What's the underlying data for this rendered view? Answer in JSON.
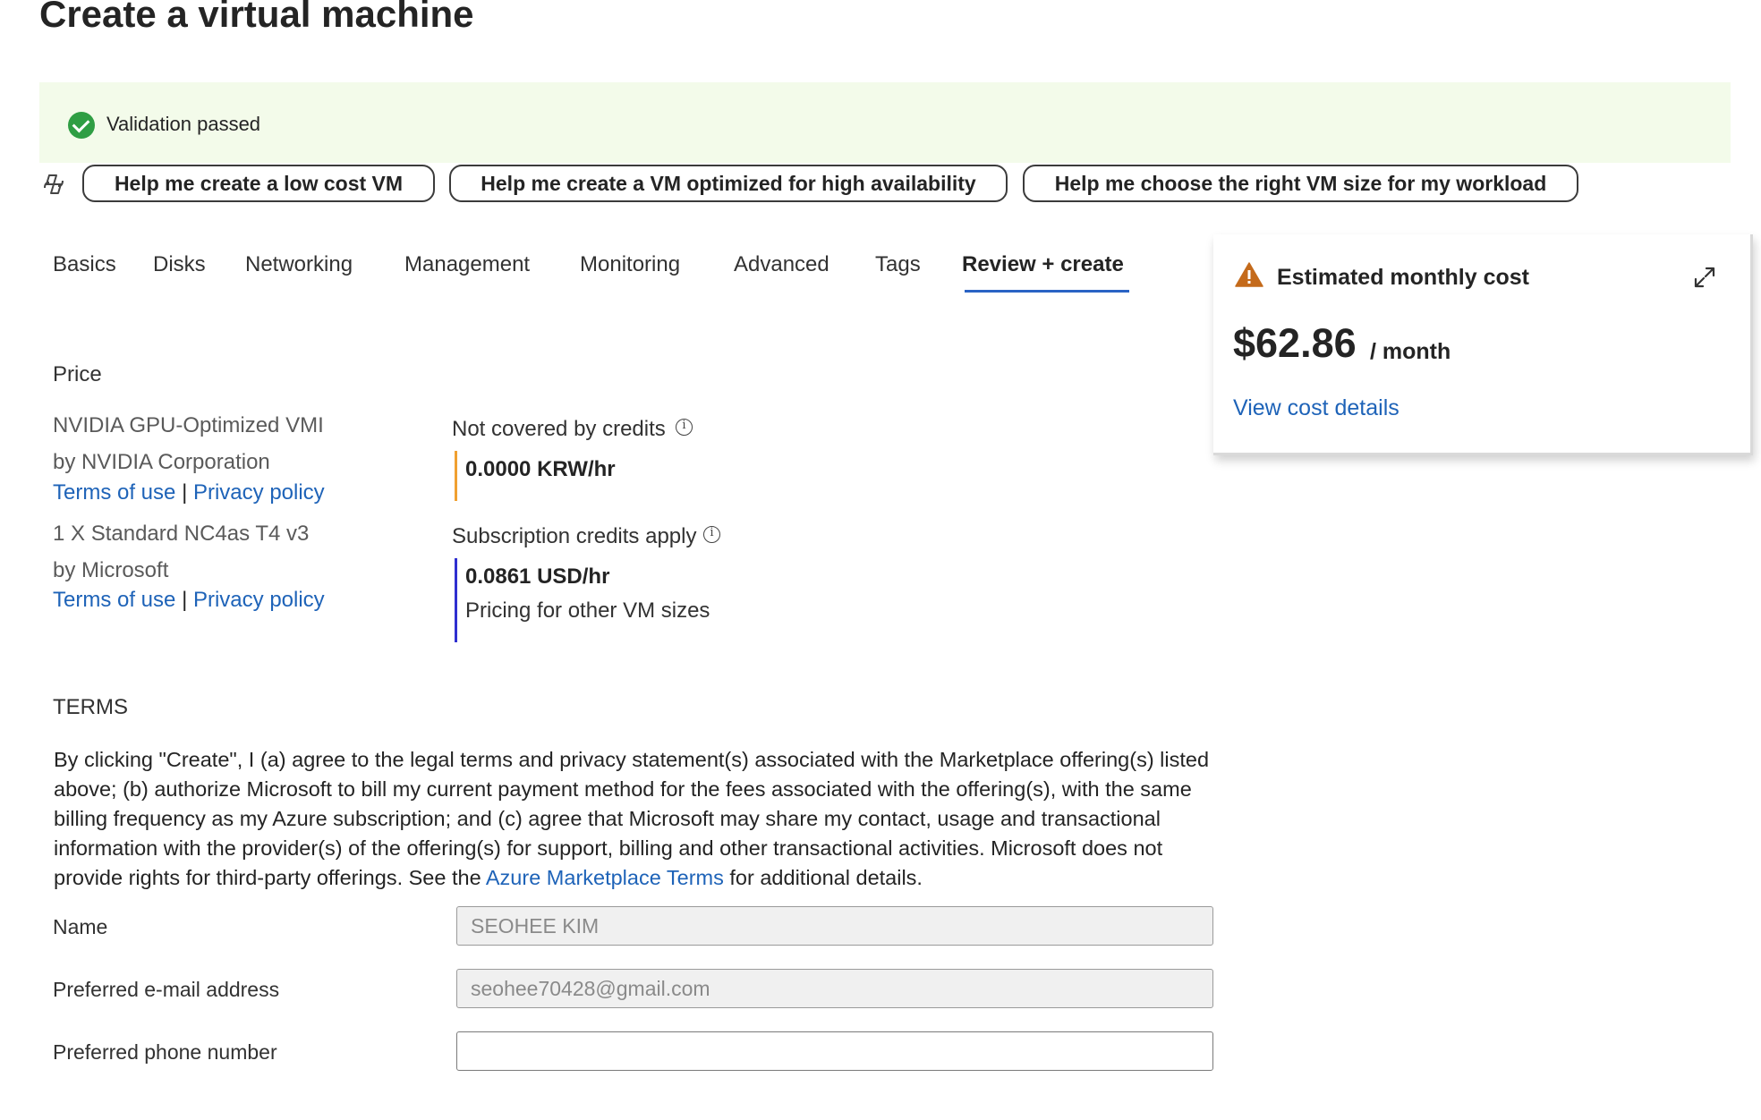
{
  "page": {
    "title": "Create a virtual machine"
  },
  "validation": {
    "text": "Validation passed",
    "color": "#2f9e44"
  },
  "copilot": {
    "icon": "copilot-icon",
    "suggestions": [
      "Help me create a low cost VM",
      "Help me create a VM optimized for high availability",
      "Help me choose the right VM size for my workload"
    ]
  },
  "tabs": [
    {
      "label": "Basics"
    },
    {
      "label": "Disks"
    },
    {
      "label": "Networking"
    },
    {
      "label": "Management"
    },
    {
      "label": "Monitoring"
    },
    {
      "label": "Advanced"
    },
    {
      "label": "Tags"
    },
    {
      "label": "Review + create",
      "active": true
    }
  ],
  "cost_card": {
    "title": "Estimated monthly cost",
    "amount": "$62.86",
    "period": "/ month",
    "link": "View cost details",
    "warning_icon": "warning-icon",
    "expand_icon": "expand-icon"
  },
  "price": {
    "heading": "Price",
    "items": [
      {
        "name": "NVIDIA GPU-Optimized VMI",
        "publisher": "by NVIDIA Corporation",
        "terms": "Terms of use",
        "separator": "|",
        "privacy": "Privacy policy"
      },
      {
        "name": "1 X Standard NC4as T4 v3",
        "publisher": "by Microsoft",
        "terms": "Terms of use",
        "separator": "|",
        "privacy": "Privacy policy"
      }
    ],
    "not_covered": {
      "label": "Not covered by credits",
      "value": "0.0000 KRW/hr"
    },
    "credits_apply": {
      "label": "Subscription credits apply",
      "value": "0.0861 USD/hr",
      "link": "Pricing for other VM sizes"
    }
  },
  "terms": {
    "heading": "TERMS",
    "body_before": "By clicking \"Create\", I (a) agree to the legal terms and privacy statement(s) associated with the Marketplace offering(s) listed above; (b) authorize Microsoft to bill my current payment method for the fees associated with the offering(s), with the same billing frequency as my Azure subscription; and (c) agree that Microsoft may share my contact, usage and transactional information with the provider(s) of the offering(s) for support, billing and other transactional activities. Microsoft does not provide rights for third-party offerings. See the ",
    "link": "Azure Marketplace Terms",
    "body_after": " for additional details."
  },
  "contact": {
    "name_label": "Name",
    "name_value": "SEOHEE KIM",
    "email_label": "Preferred e-mail address",
    "email_value": "seohee70428@gmail.com",
    "phone_label": "Preferred phone number",
    "phone_value": ""
  }
}
